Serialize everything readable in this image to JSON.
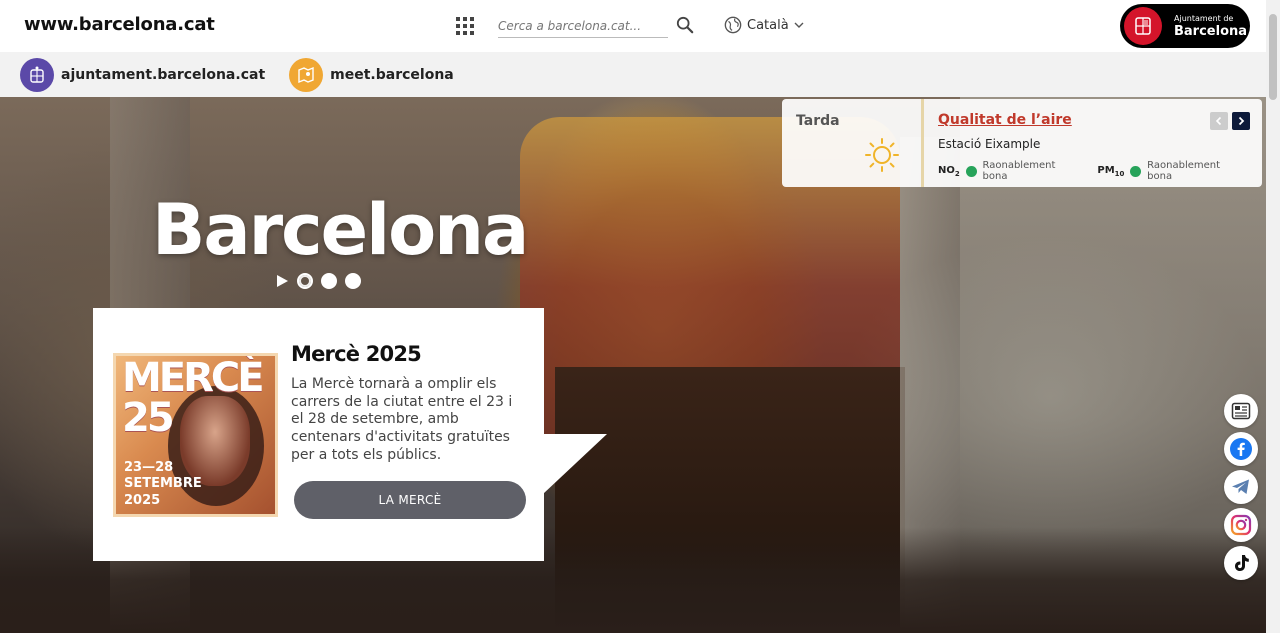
{
  "header": {
    "site_url": "www.barcelona.cat",
    "search_placeholder": "Cerca a barcelona.cat...",
    "language": "Català",
    "logo_line1": "Ajuntament de",
    "logo_line2": "Barcelona",
    "brand_color": "#d4142a"
  },
  "subnav": {
    "items": [
      {
        "label": "ajuntament.barcelona.cat",
        "icon": "city-seal-icon",
        "color": "#5b49a8"
      },
      {
        "label": "meet.barcelona",
        "icon": "map-icon",
        "color": "#f0a733"
      }
    ]
  },
  "hero": {
    "title": "Barcelona",
    "slides_total": 3,
    "active_slide": 1
  },
  "weather": {
    "time_of_day": "Tarda",
    "icon": "sun-icon",
    "air_quality_title": "Qualitat de l’aire",
    "station": "Estació Eixample",
    "no2_label": "NO",
    "no2_sub": "2",
    "no2_value": "Raonablement bona",
    "pm10_label": "PM",
    "pm10_sub": "10",
    "pm10_value": "Raonablement bona",
    "status_color": "#27a35a"
  },
  "feature": {
    "poster_title": "MERCÈ 25",
    "poster_date_line1": "23—28",
    "poster_date_line2": "SETEMBRE",
    "poster_date_line3": "2025",
    "title": "Mercè 2025",
    "text": "La Mercè tornarà a omplir els carrers de la ciutat entre el 23 i el 28 de setembre, amb centenars d'activitats gratuïtes per a tots els públics.",
    "button_label": "LA MERCÈ"
  },
  "socials": [
    "newsletter-icon",
    "facebook-icon",
    "telegram-icon",
    "instagram-icon",
    "tiktok-icon"
  ]
}
